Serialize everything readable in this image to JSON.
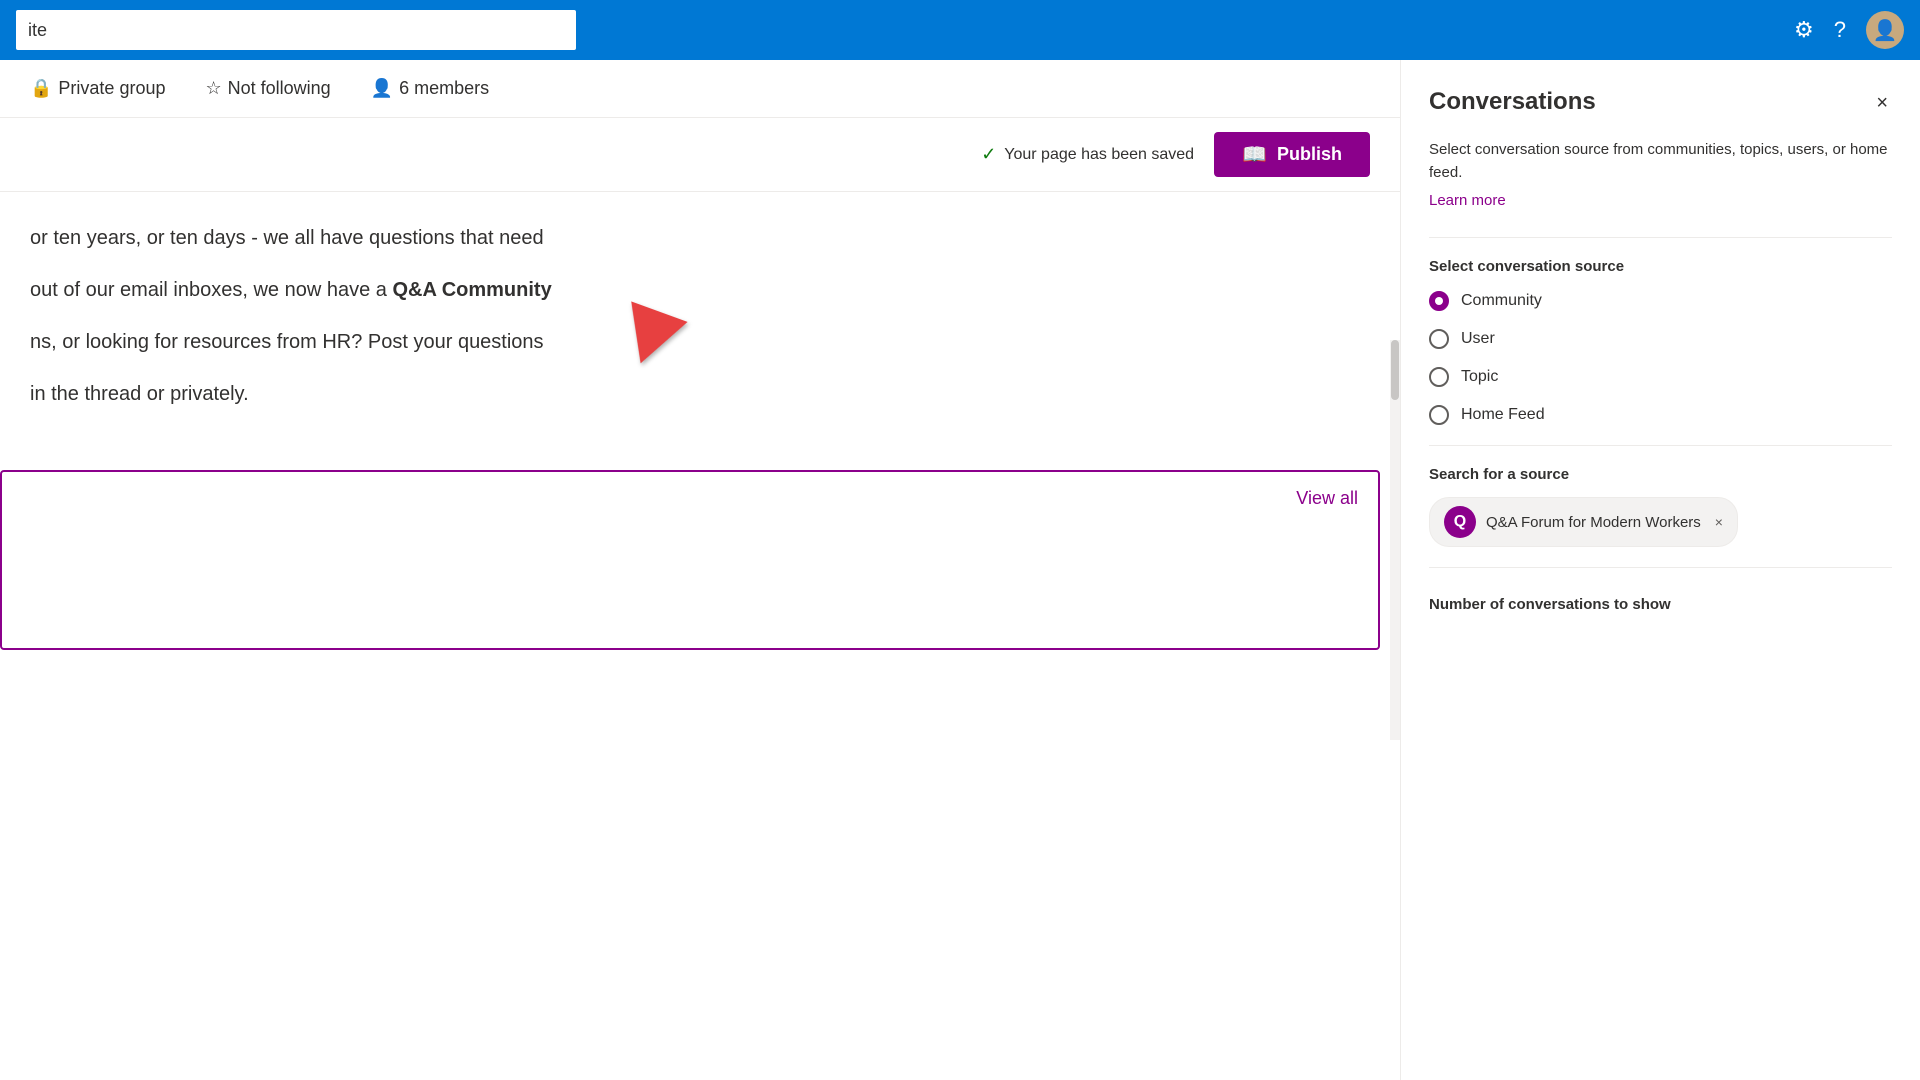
{
  "topNav": {
    "siteTitle": "ite",
    "searchPlaceholder": "",
    "icons": {
      "settings": "⚙",
      "help": "?",
      "avatar": "👤"
    }
  },
  "subHeader": {
    "privateGroup": "Private group",
    "notFollowing": "Not following",
    "membersCount": "6 members"
  },
  "toolbar": {
    "savedNotice": "Your page has been saved",
    "publishLabel": "Publish"
  },
  "content": {
    "line1": "or ten years, or ten days - we all have questions that need",
    "line2": "out of our email inboxes, we now have a",
    "boldPart": "Q&A Community",
    "line3": "ns, or looking for resources from HR?  Post your questions",
    "line4": "in the thread or privately.",
    "viewAll": "View all"
  },
  "rightPanel": {
    "title": "Conversations",
    "closeLabel": "×",
    "description": "Select conversation source from communities, topics, users, or home feed.",
    "learnMore": "Learn more",
    "selectSourceLabel": "Select conversation source",
    "radioOptions": [
      {
        "id": "community",
        "label": "Community",
        "selected": true
      },
      {
        "id": "user",
        "label": "User",
        "selected": false
      },
      {
        "id": "topic",
        "label": "Topic",
        "selected": false
      },
      {
        "id": "homefeed",
        "label": "Home Feed",
        "selected": false
      }
    ],
    "searchForSourceLabel": "Search for a source",
    "searchTag": {
      "initial": "Q",
      "text": "Q&A Forum for Modern Workers"
    },
    "numConversationsLabel": "Number of conversations to show"
  }
}
